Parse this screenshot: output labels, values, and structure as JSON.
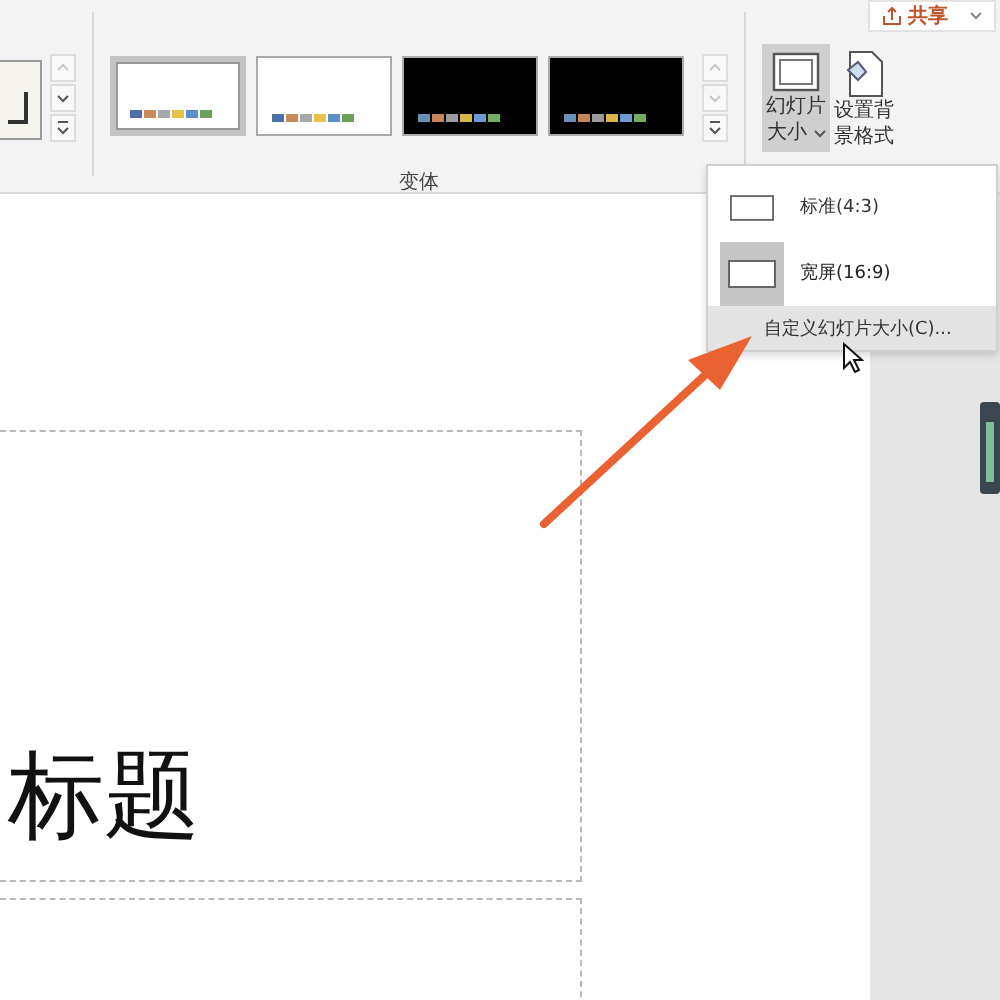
{
  "share_button": {
    "label": "共享"
  },
  "ribbon": {
    "variants": [
      {
        "kind": "light",
        "selected": true
      },
      {
        "kind": "light",
        "selected": false
      },
      {
        "kind": "dark",
        "selected": false
      },
      {
        "kind": "dark",
        "selected": false
      }
    ],
    "variants_label": "变体",
    "slide_size_button": {
      "line_1": "幻灯片",
      "line_2": "大小",
      "pressed": true
    },
    "format_background_button": {
      "line_1": "设置背",
      "line_2": "景格式"
    }
  },
  "slide_size_menu": [
    {
      "kind": "preset",
      "label": "标准(4:3)",
      "selected": false,
      "highlighted": false
    },
    {
      "kind": "preset",
      "label": "宽屏(16:9)",
      "selected": true,
      "highlighted": false
    },
    {
      "kind": "custom",
      "label": "自定义幻灯片大小(C)...",
      "highlighted": true
    }
  ],
  "slide": {
    "title_placeholder": "标题"
  }
}
